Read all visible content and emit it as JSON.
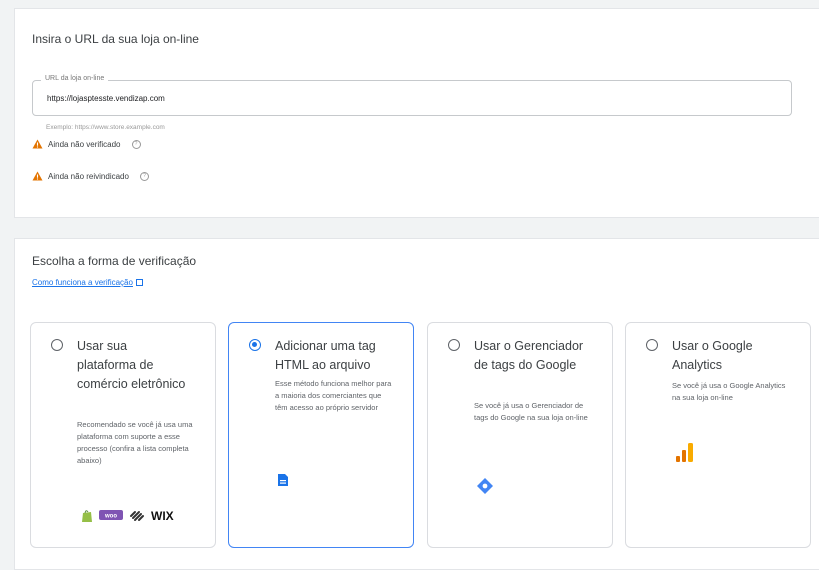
{
  "url_section": {
    "heading": "Insira o URL da sua loja on-line",
    "field_label": "URL da loja on-line",
    "field_value": "https://lojasptesste.vendizap.com",
    "example": "Exemplo: https://www.store.example.com",
    "status_verified": "Ainda não verificado",
    "status_claimed": "Ainda não reivindicado"
  },
  "verification": {
    "heading": "Escolha a forma de verificação",
    "help_link": "Como funciona a verificação",
    "options": [
      {
        "title": "Usar sua plataforma de comércio eletrônico",
        "description": "Recomendado se você já usa uma plataforma com suporte a esse processo (confira a lista completa abaixo)",
        "selected": false
      },
      {
        "title": "Adicionar uma tag HTML ao arquivo",
        "description": "Esse método funciona melhor para a maioria dos comerciantes que têm acesso ao próprio servidor",
        "selected": true
      },
      {
        "title": "Usar o Gerenciador de tags do Google",
        "description": "Se você já usa o Gerenciador de tags do Google na sua loja on-line",
        "selected": false
      },
      {
        "title": "Usar o Google Analytics",
        "description": "Se você já usa o Google Analytics na sua loja on-line",
        "selected": false
      }
    ],
    "platform_logos": [
      "shopify-logo",
      "woocommerce-logo",
      "squarespace-logo",
      "WIX"
    ]
  },
  "colors": {
    "accent": "#1a73e8",
    "warning": "#e37400",
    "analytics_orange": "#f9ab00",
    "gtm_blue": "#4285f4"
  }
}
